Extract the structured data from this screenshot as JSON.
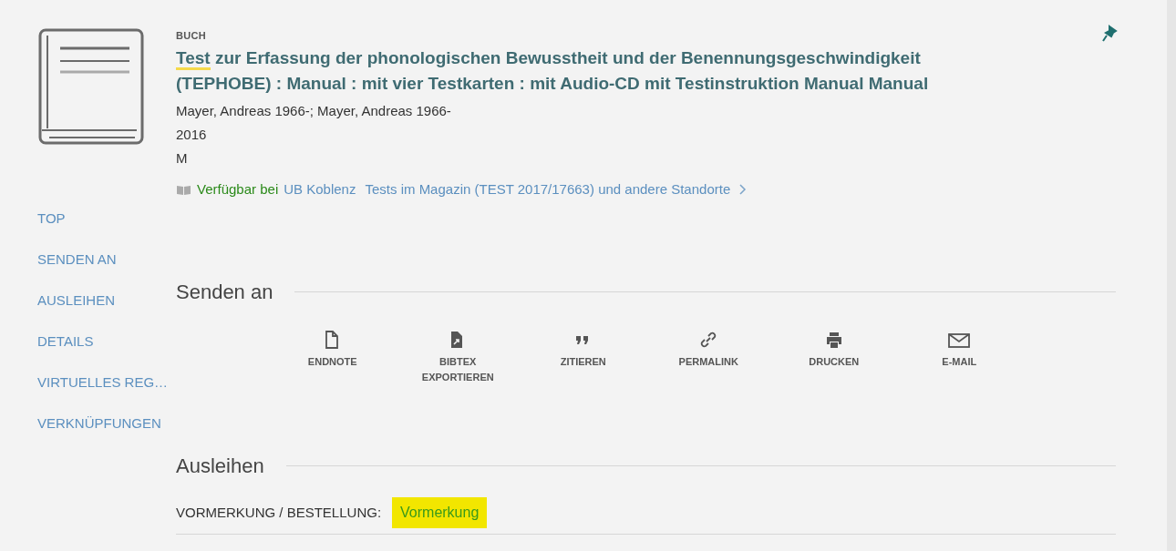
{
  "nav": [
    {
      "label": "TOP"
    },
    {
      "label": "SENDEN AN"
    },
    {
      "label": "AUSLEIHEN"
    },
    {
      "label": "DETAILS"
    },
    {
      "label": "VIRTUELLES REG…"
    },
    {
      "label": "VERKNÜPFUNGEN"
    }
  ],
  "record": {
    "type": "BUCH",
    "title_parts": [
      {
        "text": "Test",
        "highlighted": true
      },
      {
        "text": " zur Erfassung der phonologischen Bewusstheit und der Benennungsgeschwindigkeit (TEPHOBE) : Manual : mit vier Testkarten : mit Audio-CD mit Testinstruktion Manual Manual",
        "highlighted": false
      }
    ],
    "authors": "Mayer, Andreas 1966-; Mayer, Andreas 1966-",
    "year": "2016",
    "edition": "M",
    "availability": {
      "status": "Verfügbar bei",
      "library": "UB Koblenz",
      "location": "Tests im Magazin (TEST 2017/17663) und andere Standorte"
    }
  },
  "send_to": {
    "heading": "Senden an",
    "actions": [
      {
        "kind": "file",
        "label": "ENDNOTE"
      },
      {
        "kind": "export",
        "label": "BIBTEX EXPORTIEREN"
      },
      {
        "kind": "quote",
        "label": "ZITIEREN"
      },
      {
        "kind": "link",
        "label": "PERMALINK"
      },
      {
        "kind": "print",
        "label": "DRUCKEN"
      },
      {
        "kind": "mail",
        "label": "E-MAIL"
      }
    ]
  },
  "loan": {
    "heading": "Ausleihen",
    "label": "VORMERKUNG / BESTELLUNG:",
    "option": {
      "text": "Vormerkung",
      "highlighted": true
    }
  }
}
